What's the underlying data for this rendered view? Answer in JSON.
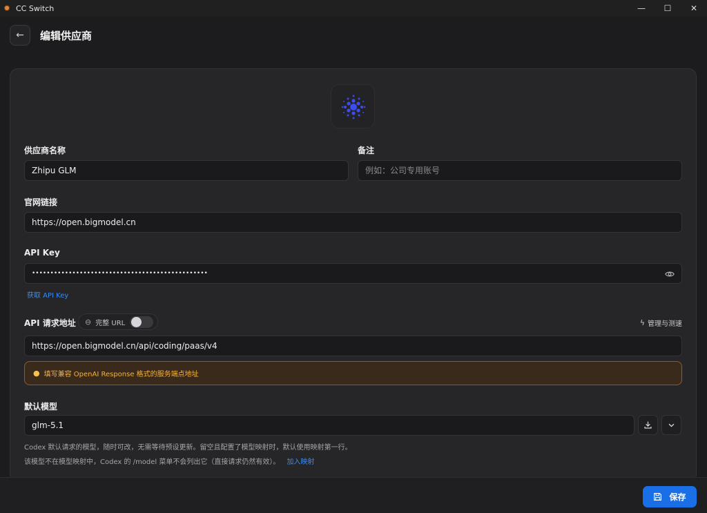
{
  "window": {
    "title": "CC Switch",
    "app_icon_glyph": "✹",
    "minimize_glyph": "—",
    "maximize_glyph": "☐",
    "close_glyph": "✕"
  },
  "header": {
    "back_glyph": "←",
    "title": "编辑供应商"
  },
  "form": {
    "provider_name_label": "供应商名称",
    "provider_name_value": "Zhipu GLM",
    "notes_label": "备注",
    "notes_placeholder": "例如：公司专用账号",
    "website_label": "官网链接",
    "website_value": "https://open.bigmodel.cn",
    "api_key_label": "API Key",
    "api_key_value": "••••••••••••••••••••••••••••••••••••••••••••••••",
    "get_api_key_link": "获取 API Key",
    "api_url_label": "API 请求地址",
    "full_url_toggle_label": "完整 URL",
    "full_url_enabled": false,
    "manage_test_link": "管理与测速",
    "api_url_value": "https://open.bigmodel.cn/api/coding/paas/v4",
    "warning_text": "填写兼容 OpenAI Response 格式的服务端点地址",
    "default_model_label": "默认模型",
    "default_model_value": "glm-5.1",
    "hint_line1": "Codex 默认请求的模型，随时可改，无需等待预设更新。留空且配置了模型映射时，默认使用映射第一行。",
    "hint_line2": "该模型不在模型映射中，Codex 的 /model 菜单不会列出它（直接请求仍然有效）。",
    "add_mapping_link": "加入映射"
  },
  "footer": {
    "save_label": "保存"
  },
  "colors": {
    "accent": "#1a6fe6",
    "link": "#3b8cf0",
    "warning": "#f3b23a",
    "logo": "#3b4cf0"
  }
}
